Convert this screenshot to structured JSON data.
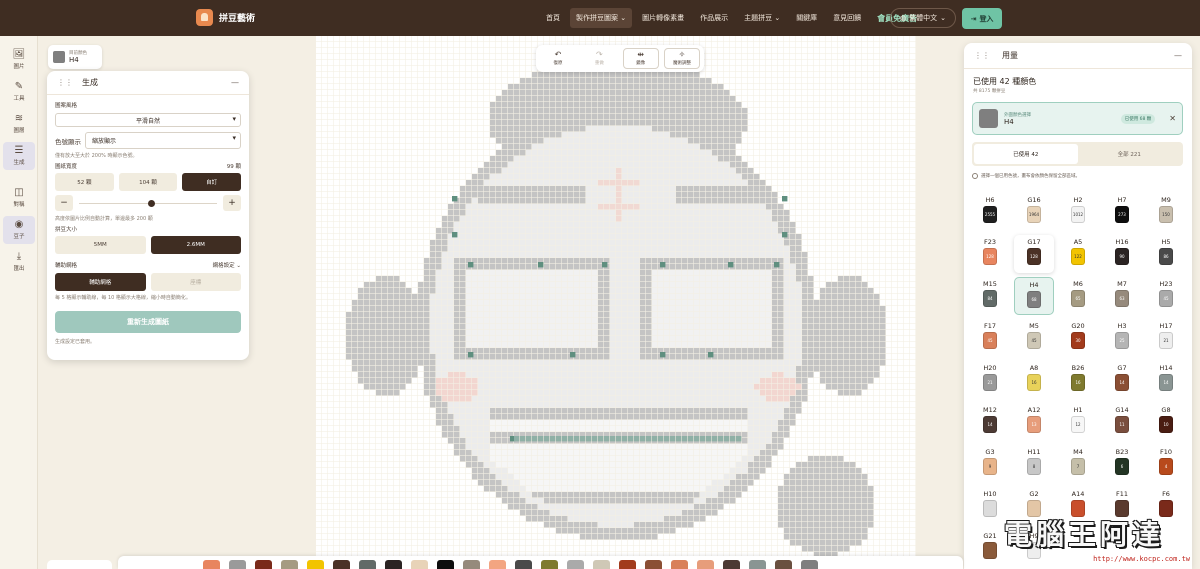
{
  "header": {
    "logo_text": "拼豆藝術",
    "nav": [
      {
        "label": "首頁"
      },
      {
        "label": "製作拼豆圖案 ⌄",
        "active": true
      },
      {
        "label": "圖片轉像素畫"
      },
      {
        "label": "作品展示"
      },
      {
        "label": "主題拼豆 ⌄"
      },
      {
        "label": "關鍵庫"
      },
      {
        "label": "意見回饋"
      },
      {
        "label": "會員免廣告",
        "premium": true
      }
    ],
    "language": "繁體中文",
    "login": "登入"
  },
  "rail": [
    {
      "label": "圖片",
      "icon": "image-icon",
      "glyph": "🖼"
    },
    {
      "label": "工具",
      "icon": "brush-icon",
      "glyph": "✎"
    },
    {
      "label": "圖層",
      "icon": "layers-icon",
      "glyph": "≋"
    },
    {
      "label": "生成",
      "icon": "sliders-icon",
      "glyph": "☰",
      "active": true
    },
    {
      "label": "對稱",
      "icon": "mirror-icon",
      "glyph": "◫"
    },
    {
      "label": "豆子",
      "icon": "palette-icon",
      "glyph": "◉",
      "active": true
    },
    {
      "label": "匯出",
      "icon": "download-icon",
      "glyph": "⤓"
    }
  ],
  "color_chip": {
    "label": "目前顏色",
    "code": "H4",
    "color": "#7f7f7f"
  },
  "toolbar": {
    "undo": "復原",
    "redo": "重做",
    "mirror": "鏡像",
    "magic": "魔術調整"
  },
  "generate": {
    "title": "生成",
    "style_label": "圖案風格",
    "style_value": "平滑自然",
    "color_display_label": "色號顯示",
    "color_display_value": "縮放顯示",
    "color_hint": "僅有放大至大於 200% 時顯示色號。",
    "width_label": "圖紙寬度",
    "width_value": "99 顆",
    "width_options": [
      "52 顆",
      "104 顆",
      "自訂"
    ],
    "width_active": 2,
    "width_hint": "高度依圖片比例自動計算，單邊最多 200 顆",
    "slider_fraction": 0.5,
    "bead_size_label": "拼豆大小",
    "bead_sizes": [
      "5MM",
      "2.6MM"
    ],
    "bead_size_active": 1,
    "guide_label": "輔助網格",
    "guide_setting": "網格設定 ⌄",
    "guide_options": [
      "輔助網格",
      "座標"
    ],
    "guide_hint": "每 5 格顯示輔助線，每 10 格顯示大格線，縮小時自動簡化。",
    "regen_button": "重新生成圖紙",
    "footer": "生成設定已套用。"
  },
  "usage": {
    "title": "用量",
    "used_title": "已使用 42 種顏色",
    "used_sub": "共 8175 顆拼豆",
    "selected": {
      "small": "外圍顏色選擇",
      "code": "H4",
      "badge": "已使用 68 顆",
      "color": "#7f7f7f"
    },
    "tab_used": "已使用 42",
    "tab_all": "全部 221",
    "info": "選擇一個已用色號，畫布會依顏色保留全部區域。",
    "beads": [
      {
        "code": "H6",
        "count": "2555",
        "color": "#1f1f1f"
      },
      {
        "code": "G16",
        "count": "1964",
        "color": "#e8d3b8",
        "light": true
      },
      {
        "code": "H2",
        "count": "1012",
        "color": "#f3f3f3",
        "light": true
      },
      {
        "code": "H7",
        "count": "273",
        "color": "#0e0e0e"
      },
      {
        "code": "M9",
        "count": "150",
        "color": "#c9bfae",
        "light": true
      },
      {
        "code": "F23",
        "count": "128",
        "color": "#e8855f"
      },
      {
        "code": "G17",
        "count": "128",
        "color": "#4b3226"
      },
      {
        "code": "A5",
        "count": "122",
        "color": "#f2c400",
        "light": true
      },
      {
        "code": "H16",
        "count": "90",
        "color": "#2b2423"
      },
      {
        "code": "H5",
        "count": "86",
        "color": "#4a4a4a"
      },
      {
        "code": "M15",
        "count": "84",
        "color": "#616a67"
      },
      {
        "code": "H4",
        "count": "68",
        "color": "#7f7f7f"
      },
      {
        "code": "M6",
        "count": "65",
        "color": "#a59b82"
      },
      {
        "code": "M7",
        "count": "63",
        "color": "#968a7c"
      },
      {
        "code": "H23",
        "count": "45",
        "color": "#aaaaaa"
      },
      {
        "code": "F17",
        "count": "45",
        "color": "#d9805a"
      },
      {
        "code": "M5",
        "count": "45",
        "color": "#cfc8b6",
        "light": true
      },
      {
        "code": "G20",
        "count": "30",
        "color": "#a23b1c"
      },
      {
        "code": "H3",
        "count": "25",
        "color": "#b5b5b5"
      },
      {
        "code": "H17",
        "count": "21",
        "color": "#eeeeee",
        "light": true
      },
      {
        "code": "H20",
        "count": "21",
        "color": "#9a9a9a"
      },
      {
        "code": "A8",
        "count": "16",
        "color": "#e8d25a",
        "light": true
      },
      {
        "code": "B26",
        "count": "16",
        "color": "#7f7a2e"
      },
      {
        "code": "G7",
        "count": "14",
        "color": "#8b4f34"
      },
      {
        "code": "H14",
        "count": "14",
        "color": "#8a9593"
      },
      {
        "code": "M12",
        "count": "14",
        "color": "#4c3a34"
      },
      {
        "code": "A12",
        "count": "13",
        "color": "#e79d7b"
      },
      {
        "code": "H1",
        "count": "12",
        "color": "#f7f7f7",
        "light": true
      },
      {
        "code": "G14",
        "count": "11",
        "color": "#7a4e3e"
      },
      {
        "code": "G8",
        "count": "10",
        "color": "#4a1d12"
      },
      {
        "code": "G3",
        "count": "9",
        "color": "#e8b48a",
        "light": true
      },
      {
        "code": "H11",
        "count": "8",
        "color": "#c7c7c7",
        "light": true
      },
      {
        "code": "M4",
        "count": "7",
        "color": "#c5bfa9",
        "light": true
      },
      {
        "code": "B23",
        "count": "6",
        "color": "#233524"
      },
      {
        "code": "F10",
        "count": "4",
        "color": "#b84a1c"
      },
      {
        "code": "H10",
        "count": "",
        "color": "#dcdcdc",
        "light": true
      },
      {
        "code": "G2",
        "count": "",
        "color": "#e3c6a6",
        "light": true
      },
      {
        "code": "A14",
        "count": "",
        "color": "#c94f2c"
      },
      {
        "code": "F11",
        "count": "",
        "color": "#5a3a2e"
      },
      {
        "code": "F6",
        "count": "",
        "color": "#7a2a1a"
      },
      {
        "code": "G21",
        "count": "",
        "color": "#8a5a3a"
      },
      {
        "code": "H9",
        "count": "",
        "color": "#eeeeee",
        "light": true
      }
    ]
  },
  "bottom_palette": [
    "#e8855f",
    "#9a9a9a",
    "#7a2a1a",
    "#a59b82",
    "#f2c400",
    "#4b3226",
    "#616a67",
    "#2b2423",
    "#e8d3b8",
    "#0e0e0e",
    "#968a7c",
    "#f3a581",
    "#4a4a4a",
    "#7f7a2e",
    "#aaaaaa",
    "#cfc8b6",
    "#a23b1c",
    "#8b4f34",
    "#d9805a",
    "#e79d7b",
    "#4c3a34",
    "#8a9593",
    "#6a5040",
    "#7f7f7f"
  ],
  "watermark": {
    "text": "電腦王阿達",
    "url": "http://www.kocpc.com.tw"
  }
}
